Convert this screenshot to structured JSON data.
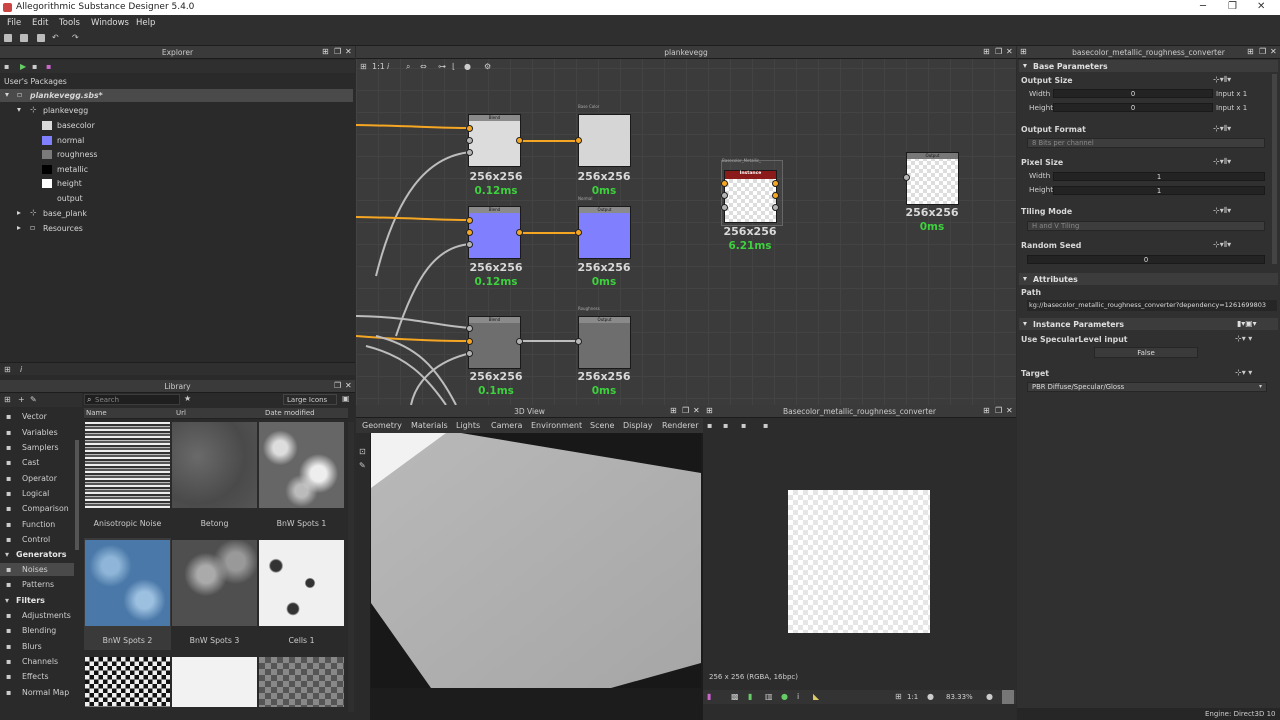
{
  "window": {
    "title": "Allegorithmic Substance Designer 5.4.0"
  },
  "menu": [
    "File",
    "Edit",
    "Tools",
    "Windows",
    "Help"
  ],
  "explorer": {
    "title": "Explorer",
    "user_packages": "User's Packages",
    "package": "plankevegg.sbs*",
    "graph": "plankevegg",
    "outputs": [
      {
        "label": "basecolor",
        "color": "#d9d9d9"
      },
      {
        "label": "normal",
        "color": "#8080ff"
      },
      {
        "label": "roughness",
        "color": "#7a7a7a"
      },
      {
        "label": "metallic",
        "color": "#000000"
      },
      {
        "label": "height",
        "color": "#ffffff"
      }
    ],
    "output_item": "output",
    "base_plank": "base_plank",
    "resources": "Resources"
  },
  "library": {
    "title": "Library",
    "search_placeholder": "Search",
    "view_mode": "Large Icons",
    "columns": [
      "Name",
      "Url",
      "Date modified"
    ],
    "categories_top": [
      "Vector",
      "Variables",
      "Samplers",
      "Cast",
      "Operator",
      "Logical",
      "Comparison",
      "Function",
      "Control"
    ],
    "generators_head": "Generators",
    "generators": [
      "Noises",
      "Patterns"
    ],
    "filters_head": "Filters",
    "filters": [
      "Adjustments",
      "Blending",
      "Blurs",
      "Channels",
      "Effects",
      "Normal Map"
    ],
    "thumbs": [
      "Anisotropic Noise",
      "Betong",
      "BnW Spots 1",
      "BnW Spots 2",
      "BnW Spots 3",
      "Cells 1"
    ]
  },
  "graph": {
    "title": "plankevegg",
    "zoom": "1:1",
    "nodes": [
      {
        "res": "256x256",
        "time": "0.12ms"
      },
      {
        "res": "256x256",
        "time": "0ms"
      },
      {
        "res": "256x256",
        "time": "0.12ms"
      },
      {
        "res": "256x256",
        "time": "0ms"
      },
      {
        "res": "256x256",
        "time": "0.1ms"
      },
      {
        "res": "256x256",
        "time": "0ms"
      },
      {
        "res": "256x256",
        "time": "6.21ms"
      },
      {
        "res": "256x256",
        "time": "0ms"
      }
    ],
    "node_heads": {
      "blend": "Blend",
      "output": "Output",
      "instance": "Instance"
    },
    "node_captions": {
      "basecolor": "Base Color",
      "normal": "Normal",
      "roughness": "Roughness",
      "converter": "Basecolor_Metallic_"
    }
  },
  "view3d": {
    "title": "3D View",
    "menu": [
      "Geometry",
      "Materials",
      "Lights",
      "Camera",
      "Environment",
      "Scene",
      "Display",
      "Renderer"
    ]
  },
  "view2d": {
    "title": "Basecolor_metallic_roughness_converter",
    "info": "256 x 256 (RGBA, 16bpc)",
    "zoom_ratio": "1:1",
    "zoom": "83.33%"
  },
  "props": {
    "title": "basecolor_metallic_roughness_converter",
    "base_params": "Base Parameters",
    "output_size": "Output Size",
    "width": "Width",
    "height": "Height",
    "width_val": "0",
    "height_val": "0",
    "input_x1": "Input x 1",
    "output_format": "Output Format",
    "output_format_val": "8 Bits per channel",
    "pixel_size": "Pixel Size",
    "pixel_w": "1",
    "pixel_h": "1",
    "tiling_mode": "Tiling Mode",
    "tiling_val": "H and V Tiling",
    "random_seed": "Random Seed",
    "seed_val": "0",
    "attributes": "Attributes",
    "path": "Path",
    "path_val": "kg://basecolor_metallic_roughness_converter?dependency=1261699803",
    "instance_params": "Instance Parameters",
    "specular": "Use SpecularLevel input",
    "specular_val": "False",
    "target": "Target",
    "target_val": "PBR Diffuse/Specular/Gloss"
  },
  "status": {
    "engine": "Engine: Direct3D 10"
  },
  "colors": {
    "accent_orange": "#f5a623",
    "time_green": "#3ed13e",
    "instance_red": "#8b1a1a",
    "normal_blue": "#8080ff"
  }
}
